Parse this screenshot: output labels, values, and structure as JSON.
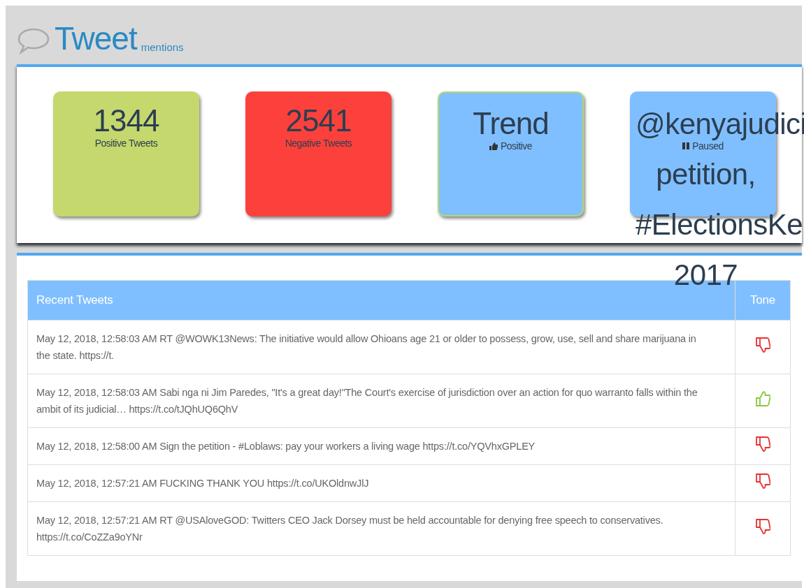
{
  "header": {
    "title": "Tweet",
    "subtitle": "mentions"
  },
  "cards": [
    {
      "kind": "count",
      "value": "1344",
      "label": "Positive Tweets",
      "color": "#c5d86d"
    },
    {
      "kind": "count",
      "value": "2541",
      "label": "Negative Tweets",
      "color": "#fc413c"
    },
    {
      "kind": "trend",
      "value": "Trend",
      "label": "Positive",
      "color": "#80bfff"
    },
    {
      "kind": "topic",
      "lines": [
        "@kenyajudici",
        "petition,",
        "#ElectionsKe",
        "2017"
      ],
      "label": "Paused",
      "color": "#80bfff"
    }
  ],
  "table": {
    "columns": [
      "Recent Tweets",
      "Tone"
    ],
    "rows": [
      {
        "text": "May 12, 2018, 12:58:03 AM RT @WOWK13News: The initiative would allow Ohioans age 21 or older to possess, grow, use, sell and share marijuana in the state. https://t.",
        "kind": "negative"
      },
      {
        "text": "May 12, 2018, 12:58:03 AM Sabi nga ni Jim Paredes, \"It's a great day!\"The Court's exercise of jurisdiction over an action for quo warranto falls within the ambit of its judicial… https://t.co/tJQhUQ6QhV",
        "kind": "positive"
      },
      {
        "text": "May 12, 2018, 12:58:00 AM Sign the petition - #Loblaws: pay your workers a living wage https://t.co/YQVhxGPLEY",
        "kind": "negative"
      },
      {
        "text": "May 12, 2018, 12:57:21 AM FUCKING THANK YOU https://t.co/UKOldnwJlJ",
        "kind": "negative"
      },
      {
        "text": "May 12, 2018, 12:57:21 AM RT @USAloveGOD: Twitters CEO Jack Dorsey must be held accountable for denying free speech to conservatives. https://t.co/CoZZa9oYNr",
        "kind": "negative"
      }
    ]
  }
}
